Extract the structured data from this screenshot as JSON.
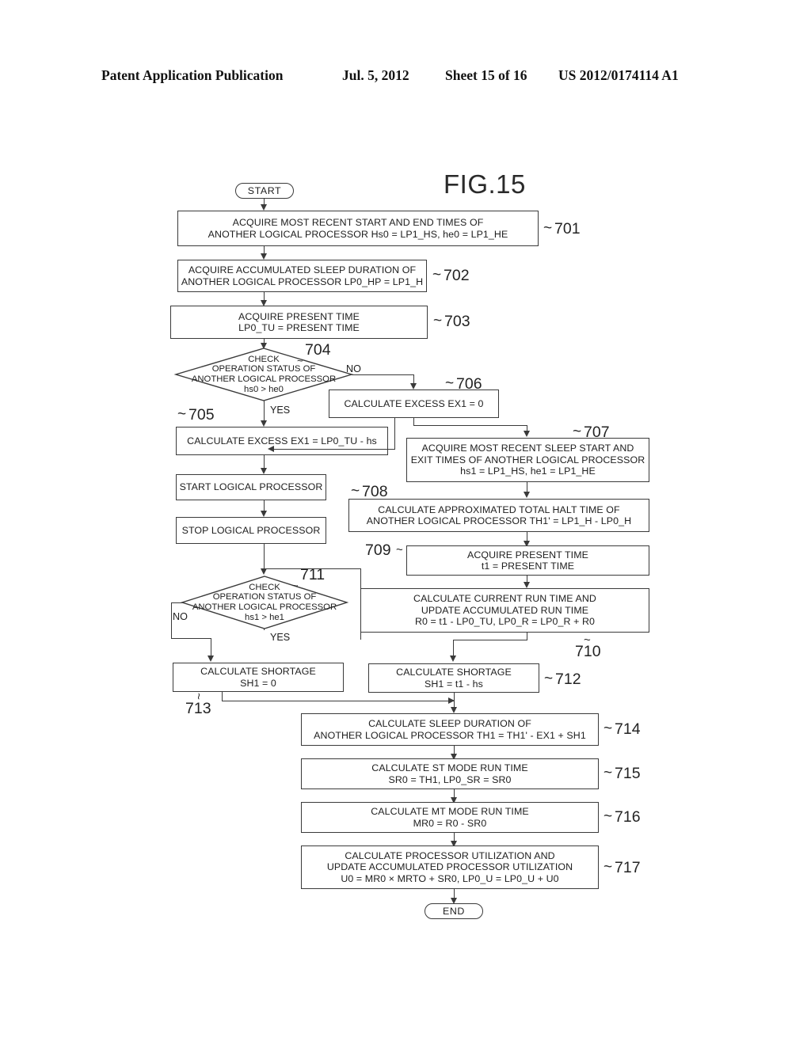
{
  "header": {
    "publication": "Patent Application Publication",
    "date": "Jul. 5, 2012",
    "sheet": "Sheet 15 of 16",
    "number": "US 2012/0174114 A1"
  },
  "figure": {
    "title": "FIG.15"
  },
  "terminators": {
    "start": "START",
    "end": "END"
  },
  "branch_labels": {
    "d704_no": "NO",
    "d704_yes": "YES",
    "d711_no": "NO",
    "d711_yes": "YES"
  },
  "nodes": {
    "n701": {
      "ref": "701",
      "line1": "ACQUIRE MOST RECENT START AND END TIMES OF",
      "line2": "ANOTHER LOGICAL PROCESSOR Hs0 = LP1_HS, he0 = LP1_HE"
    },
    "n702": {
      "ref": "702",
      "line1": "ACQUIRE ACCUMULATED SLEEP DURATION OF",
      "line2": "ANOTHER LOGICAL PROCESSOR LP0_HP = LP1_H"
    },
    "n703": {
      "ref": "703",
      "line1": "ACQUIRE PRESENT TIME",
      "line2": "LP0_TU = PRESENT TIME"
    },
    "n704": {
      "ref": "704",
      "line1": "CHECK",
      "line2": "OPERATION STATUS OF",
      "line3": "ANOTHER LOGICAL PROCESSOR",
      "line4": "hs0 > he0"
    },
    "n705": {
      "ref": "705",
      "line1": "CALCULATE EXCESS EX1 = LP0_TU - hs"
    },
    "n706": {
      "ref": "706",
      "line1": "CALCULATE EXCESS EX1 = 0"
    },
    "n707": {
      "ref": "707",
      "line1": "ACQUIRE MOST RECENT SLEEP START AND",
      "line2": "EXIT TIMES OF ANOTHER LOGICAL PROCESSOR",
      "line3": "hs1 = LP1_HS, he1 = LP1_HE"
    },
    "n708": {
      "ref": "708",
      "line1": "CALCULATE APPROXIMATED TOTAL HALT TIME OF",
      "line2": "ANOTHER LOGICAL PROCESSOR TH1' = LP1_H - LP0_H"
    },
    "n709": {
      "ref": "709",
      "line1": "ACQUIRE PRESENT TIME",
      "line2": "t1 = PRESENT TIME"
    },
    "n710": {
      "ref": "710",
      "line1": "CALCULATE CURRENT RUN TIME AND",
      "line2": "UPDATE ACCUMULATED RUN TIME",
      "line3": "R0 = t1 - LP0_TU, LP0_R = LP0_R + R0"
    },
    "n711": {
      "ref": "711",
      "line1": "CHECK",
      "line2": "OPERATION STATUS OF",
      "line3": "ANOTHER LOGICAL PROCESSOR",
      "line4": "hs1 > he1"
    },
    "n712": {
      "ref": "712",
      "line1": "CALCULATE SHORTAGE",
      "line2": "SH1 = t1 - hs"
    },
    "n713": {
      "ref": "713",
      "line1": "CALCULATE SHORTAGE",
      "line2": "SH1 = 0"
    },
    "n714": {
      "ref": "714",
      "line1": "CALCULATE SLEEP DURATION OF",
      "line2": "ANOTHER LOGICAL PROCESSOR TH1 = TH1' - EX1 + SH1"
    },
    "n715": {
      "ref": "715",
      "line1": "CALCULATE ST MODE RUN TIME",
      "line2": "SR0 = TH1, LP0_SR = SR0"
    },
    "n716": {
      "ref": "716",
      "line1": "CALCULATE MT MODE RUN TIME",
      "line2": "MR0 = R0 - SR0"
    },
    "n717": {
      "ref": "717",
      "line1": "CALCULATE PROCESSOR UTILIZATION AND",
      "line2": "UPDATE ACCUMULATED PROCESSOR UTILIZATION",
      "line3": "U0 = MR0 × MRTO + SR0, LP0_U = LP0_U + U0"
    },
    "start_lp": {
      "line1": "START LOGICAL PROCESSOR"
    },
    "stop_lp": {
      "line1": "STOP LOGICAL PROCESSOR"
    }
  },
  "colors": {
    "ink": "#3a3a3a",
    "text": "#202020",
    "background": "#ffffff"
  }
}
